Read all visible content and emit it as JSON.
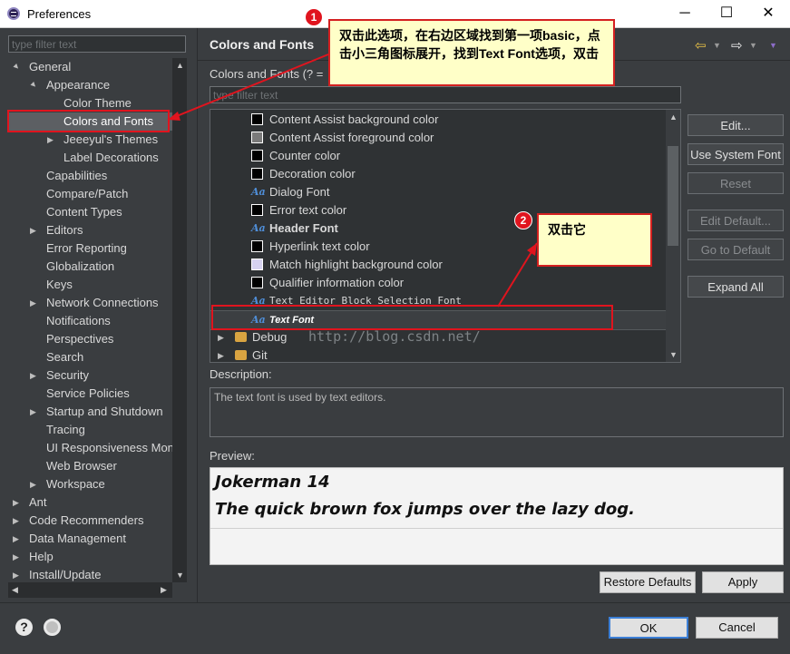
{
  "window": {
    "title": "Preferences",
    "min": "─",
    "max": "☐",
    "close": "✕"
  },
  "left": {
    "filter_placeholder": "type filter text",
    "tree": [
      {
        "label": "General",
        "depth": 0,
        "expander": "▲"
      },
      {
        "label": "Appearance",
        "depth": 1,
        "expander": "▲"
      },
      {
        "label": "Color Theme",
        "depth": 2,
        "expander": ""
      },
      {
        "label": "Colors and Fonts",
        "depth": 2,
        "expander": "",
        "selected": true
      },
      {
        "label": "Jeeeyul's Themes",
        "depth": 2,
        "expander": "▶"
      },
      {
        "label": "Label Decorations",
        "depth": 2,
        "expander": ""
      },
      {
        "label": "Capabilities",
        "depth": 1,
        "expander": ""
      },
      {
        "label": "Compare/Patch",
        "depth": 1,
        "expander": ""
      },
      {
        "label": "Content Types",
        "depth": 1,
        "expander": ""
      },
      {
        "label": "Editors",
        "depth": 1,
        "expander": "▶"
      },
      {
        "label": "Error Reporting",
        "depth": 1,
        "expander": ""
      },
      {
        "label": "Globalization",
        "depth": 1,
        "expander": ""
      },
      {
        "label": "Keys",
        "depth": 1,
        "expander": ""
      },
      {
        "label": "Network Connections",
        "depth": 1,
        "expander": "▶"
      },
      {
        "label": "Notifications",
        "depth": 1,
        "expander": ""
      },
      {
        "label": "Perspectives",
        "depth": 1,
        "expander": ""
      },
      {
        "label": "Search",
        "depth": 1,
        "expander": ""
      },
      {
        "label": "Security",
        "depth": 1,
        "expander": "▶"
      },
      {
        "label": "Service Policies",
        "depth": 1,
        "expander": ""
      },
      {
        "label": "Startup and Shutdown",
        "depth": 1,
        "expander": "▶"
      },
      {
        "label": "Tracing",
        "depth": 1,
        "expander": ""
      },
      {
        "label": "UI Responsiveness Mon",
        "depth": 1,
        "expander": ""
      },
      {
        "label": "Web Browser",
        "depth": 1,
        "expander": ""
      },
      {
        "label": "Workspace",
        "depth": 1,
        "expander": "▶"
      },
      {
        "label": "Ant",
        "depth": 0,
        "expander": "▶"
      },
      {
        "label": "Code Recommenders",
        "depth": 0,
        "expander": "▶"
      },
      {
        "label": "Data Management",
        "depth": 0,
        "expander": "▶"
      },
      {
        "label": "Help",
        "depth": 0,
        "expander": "▶"
      },
      {
        "label": "Install/Update",
        "depth": 0,
        "expander": "▶"
      }
    ]
  },
  "right": {
    "title": "Colors and Fonts",
    "subtitle": "Colors and Fonts (? =",
    "filter_placeholder": "type filter text",
    "items": [
      {
        "label": "Content Assist background color",
        "kind": "color",
        "color": "#000000"
      },
      {
        "label": "Content Assist foreground color",
        "kind": "color",
        "color": "#7a7a7a"
      },
      {
        "label": "Counter color",
        "kind": "color",
        "color": "#000000"
      },
      {
        "label": "Decoration color",
        "kind": "color",
        "color": "#000000"
      },
      {
        "label": "Dialog Font",
        "kind": "font"
      },
      {
        "label": "Error text color",
        "kind": "color",
        "color": "#000000"
      },
      {
        "label": "Header Font",
        "kind": "font",
        "bold": true
      },
      {
        "label": "Hyperlink text color",
        "kind": "color",
        "color": "#000000"
      },
      {
        "label": "Match highlight background color",
        "kind": "color",
        "color": "#d6d2f0"
      },
      {
        "label": "Qualifier information color",
        "kind": "color",
        "color": "#000000"
      },
      {
        "label": "Text Editor Block Selection Font",
        "kind": "font",
        "mono": true
      },
      {
        "label": "Text Font",
        "kind": "font",
        "selected": true
      },
      {
        "label": "Debug",
        "kind": "folder"
      },
      {
        "label": "Git",
        "kind": "folder"
      }
    ],
    "buttons": {
      "edit": "Edit...",
      "use_system_font": "Use System Font",
      "reset": "Reset",
      "edit_default": "Edit Default...",
      "go_to_default": "Go to Default",
      "expand_all": "Expand All"
    },
    "description_label": "Description:",
    "description_text": "The text font is used by text editors.",
    "preview_label": "Preview:",
    "preview_line1": "Jokerman 14",
    "preview_line2": "The quick brown fox jumps over the lazy dog.",
    "restore_defaults": "Restore Defaults",
    "apply": "Apply"
  },
  "bottom": {
    "ok": "OK",
    "cancel": "Cancel",
    "help": "?"
  },
  "annotations": {
    "badge1": "1",
    "callout1": "双击此选项，在右边区域找到第一项basic，点击小三角图标展开，找到Text Font选项，双击",
    "badge2": "2",
    "callout2": "双击它",
    "watermark": "http://blog.csdn.net/"
  },
  "colors": {
    "accent_red": "#e0141e",
    "callout_bg": "#ffffc8",
    "selected_bg": "#5c5f63"
  }
}
